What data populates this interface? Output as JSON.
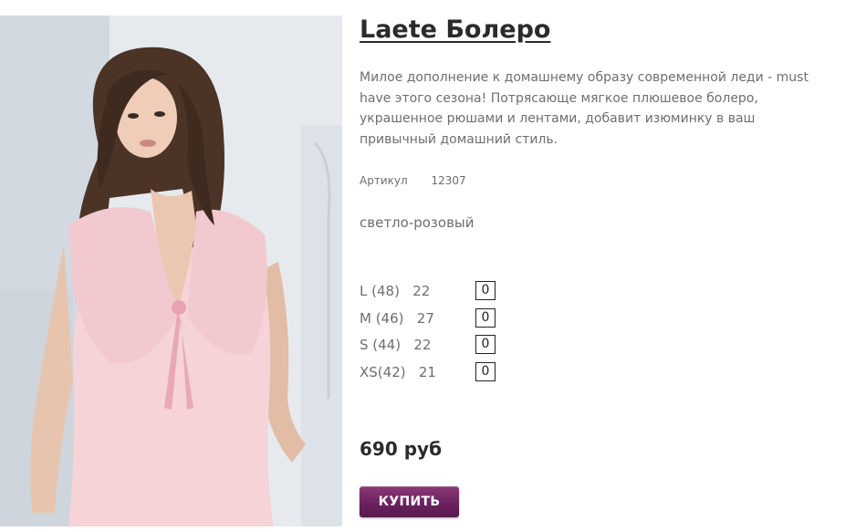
{
  "product": {
    "title": "Laete Болеро",
    "description": "Милое дополнение к домашнему образу современной леди - must have этого сезона! Потрясающе мягкое плюшевое болеро, украшенное рюшами и лентами, добавит изюминку в ваш привычный домашний стиль.",
    "article_label": "Артикул",
    "article_value": "12307",
    "color_name": "светло-розовый",
    "price": "690 руб",
    "buy_label": "КУПИТЬ"
  },
  "sizes": [
    {
      "label": "L (48)   22",
      "qty": "0"
    },
    {
      "label": "M (46)   27",
      "qty": "0"
    },
    {
      "label": "S (44)   22",
      "qty": "0"
    },
    {
      "label": "XS(42)   21",
      "qty": "0"
    }
  ],
  "colors": {
    "buy_button": "#6c2160",
    "garment": "#f3cfd4",
    "title": "#2b2b2b",
    "text": "#6e6e6e"
  }
}
